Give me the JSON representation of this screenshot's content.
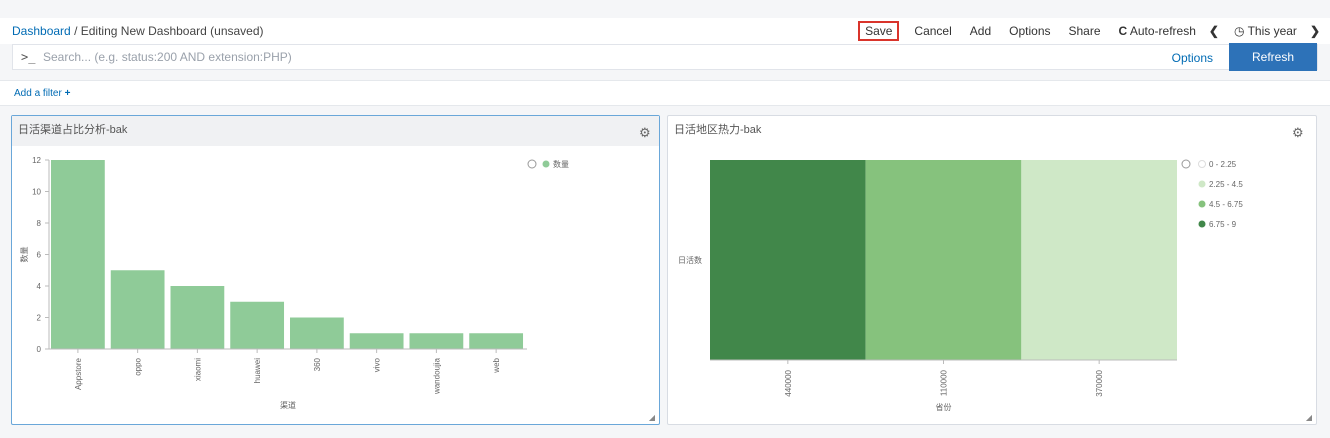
{
  "breadcrumb": {
    "root": "Dashboard",
    "separator": "/",
    "current": "Editing New Dashboard (unsaved)"
  },
  "menu": {
    "save": "Save",
    "cancel": "Cancel",
    "add": "Add",
    "options": "Options",
    "share": "Share",
    "auto_refresh": "Auto-refresh",
    "time_range": "This year"
  },
  "search": {
    "prompt": ">_",
    "placeholder": "Search... (e.g. status:200 AND extension:PHP)",
    "options_label": "Options",
    "refresh_label": "Refresh"
  },
  "filters": {
    "add_label": "Add a filter"
  },
  "colors": {
    "accent": "#006bb4",
    "button": "#2d72b8",
    "save_border": "#d9342b",
    "bar": "#8fcb98",
    "heat1": "#cfe8c7",
    "heat2": "#86c27d",
    "heat3": "#41874a"
  },
  "panels": [
    {
      "title": "日活渠道占比分析-bak",
      "icon": "gear-icon"
    },
    {
      "title": "日活地区热力-bak",
      "icon": "gear-icon"
    }
  ],
  "chart_data": [
    {
      "type": "bar",
      "categories": [
        "Appstore",
        "oppo",
        "xiaomi",
        "huawei",
        "360",
        "vivo",
        "wandoujia",
        "web"
      ],
      "series": [
        {
          "name": "数量",
          "values": [
            12,
            5,
            4,
            3,
            2,
            1,
            1,
            1
          ],
          "color": "#8fcb98"
        }
      ],
      "xlabel": "渠道",
      "ylabel": "数量",
      "ylim": [
        0,
        12
      ],
      "yticks": [
        0,
        2,
        4,
        6,
        8,
        10,
        12
      ],
      "legend": "top-right"
    },
    {
      "type": "heatmap",
      "x": [
        "440000",
        "110000",
        "370000"
      ],
      "y": [
        "日活数"
      ],
      "values": [
        [
          8,
          5,
          1
        ]
      ],
      "xlabel": "省份",
      "legend": "right",
      "legend_entries": [
        {
          "label": "0 - 2.25",
          "color": "#ffffff"
        },
        {
          "label": "2.25 - 4.5",
          "color": "#cfe8c7"
        },
        {
          "label": "4.5 - 6.75",
          "color": "#86c27d"
        },
        {
          "label": "6.75 - 9",
          "color": "#41874a"
        }
      ],
      "cell_colors": [
        "#41874a",
        "#86c27d",
        "#cfe8c7"
      ]
    }
  ]
}
